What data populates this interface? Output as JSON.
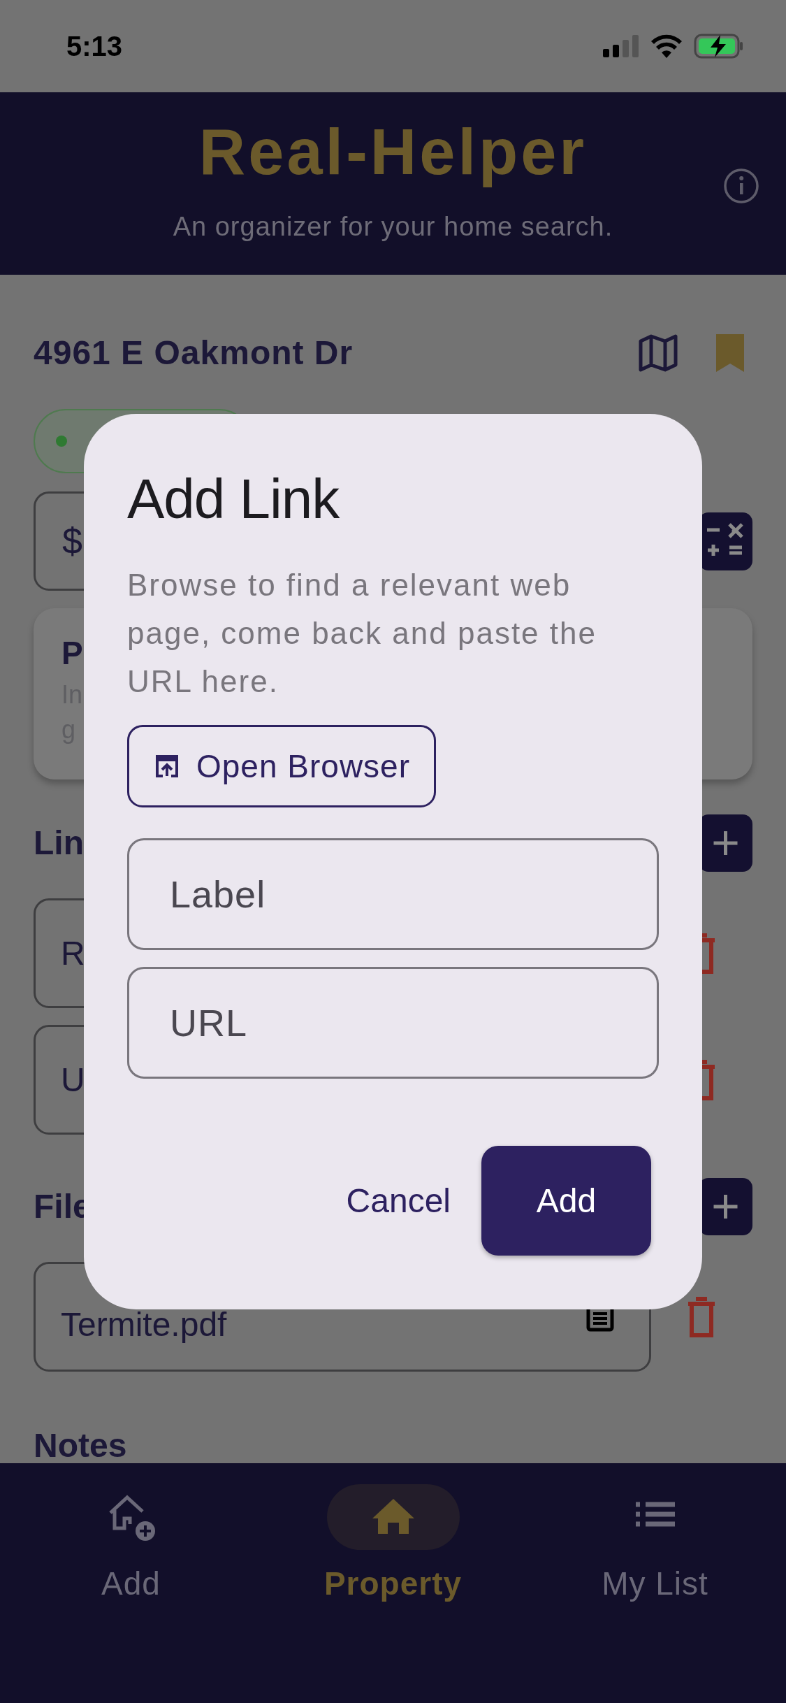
{
  "status_bar": {
    "time": "5:13"
  },
  "header": {
    "title": "Real-Helper",
    "subtitle": "An organizer for your home search."
  },
  "property": {
    "address": "4961 E Oakmont Dr",
    "bookmarked": true
  },
  "status_chip": {
    "color": "#2f7a32"
  },
  "price_field": {
    "value": "$"
  },
  "summary_card": {
    "title": "P",
    "lines": [
      "In",
      "g"
    ]
  },
  "links": {
    "heading": "Lin",
    "items": [
      {
        "label": "R"
      },
      {
        "label": "U"
      }
    ]
  },
  "files": {
    "heading": "File",
    "items": [
      {
        "name": "Termite.pdf"
      }
    ]
  },
  "notes": {
    "heading": "Notes"
  },
  "dialog": {
    "title": "Add Link",
    "message": "Browse to find a relevant web page, come back and paste the URL here.",
    "open_button": "Open Browser",
    "fields": [
      {
        "placeholder": "Label"
      },
      {
        "placeholder": "URL"
      }
    ],
    "actions": [
      {
        "label": "Cancel",
        "kind": "text"
      },
      {
        "label": "Add",
        "kind": "filled"
      }
    ]
  },
  "bottom_nav": [
    {
      "label": "Add",
      "selected": false
    },
    {
      "label": "Property",
      "selected": true
    },
    {
      "label": "My List",
      "selected": false
    }
  ]
}
